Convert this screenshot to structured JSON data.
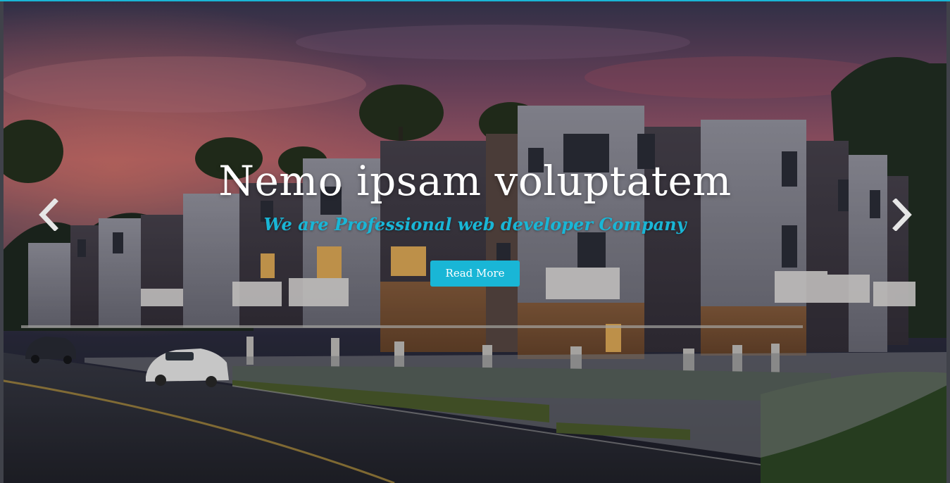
{
  "slider": {
    "title": "Nemo ipsam voluptatem",
    "subtitle": "We are Professional web developer Company",
    "button_label": "Read More",
    "prev_icon": "chevron-left-icon",
    "next_icon": "chevron-right-icon"
  },
  "colors": {
    "accent": "#19b6d6",
    "title_text": "#ffffff",
    "button_text": "#ffffff"
  }
}
